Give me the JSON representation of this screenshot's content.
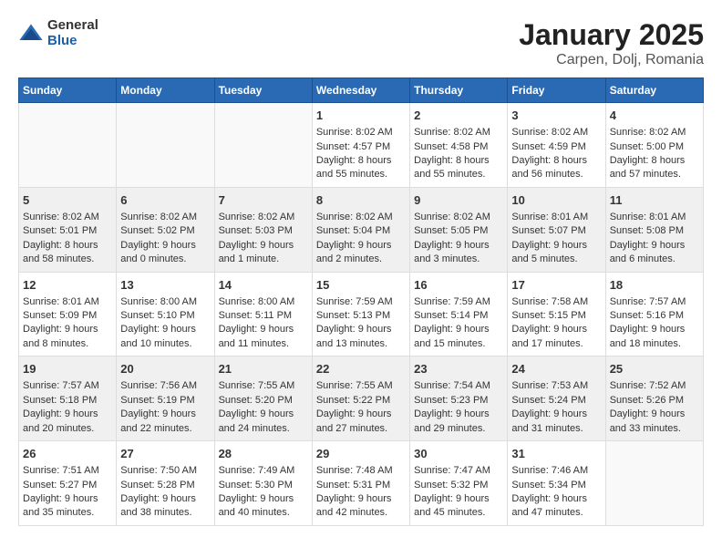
{
  "header": {
    "logo": {
      "general": "General",
      "blue": "Blue"
    },
    "title": "January 2025",
    "subtitle": "Carpen, Dolj, Romania"
  },
  "weekdays": [
    "Sunday",
    "Monday",
    "Tuesday",
    "Wednesday",
    "Thursday",
    "Friday",
    "Saturday"
  ],
  "weeks": [
    [
      {
        "day": "",
        "content": ""
      },
      {
        "day": "",
        "content": ""
      },
      {
        "day": "",
        "content": ""
      },
      {
        "day": "1",
        "content": "Sunrise: 8:02 AM\nSunset: 4:57 PM\nDaylight: 8 hours\nand 55 minutes."
      },
      {
        "day": "2",
        "content": "Sunrise: 8:02 AM\nSunset: 4:58 PM\nDaylight: 8 hours\nand 55 minutes."
      },
      {
        "day": "3",
        "content": "Sunrise: 8:02 AM\nSunset: 4:59 PM\nDaylight: 8 hours\nand 56 minutes."
      },
      {
        "day": "4",
        "content": "Sunrise: 8:02 AM\nSunset: 5:00 PM\nDaylight: 8 hours\nand 57 minutes."
      }
    ],
    [
      {
        "day": "5",
        "content": "Sunrise: 8:02 AM\nSunset: 5:01 PM\nDaylight: 8 hours\nand 58 minutes."
      },
      {
        "day": "6",
        "content": "Sunrise: 8:02 AM\nSunset: 5:02 PM\nDaylight: 9 hours\nand 0 minutes."
      },
      {
        "day": "7",
        "content": "Sunrise: 8:02 AM\nSunset: 5:03 PM\nDaylight: 9 hours\nand 1 minute."
      },
      {
        "day": "8",
        "content": "Sunrise: 8:02 AM\nSunset: 5:04 PM\nDaylight: 9 hours\nand 2 minutes."
      },
      {
        "day": "9",
        "content": "Sunrise: 8:02 AM\nSunset: 5:05 PM\nDaylight: 9 hours\nand 3 minutes."
      },
      {
        "day": "10",
        "content": "Sunrise: 8:01 AM\nSunset: 5:07 PM\nDaylight: 9 hours\nand 5 minutes."
      },
      {
        "day": "11",
        "content": "Sunrise: 8:01 AM\nSunset: 5:08 PM\nDaylight: 9 hours\nand 6 minutes."
      }
    ],
    [
      {
        "day": "12",
        "content": "Sunrise: 8:01 AM\nSunset: 5:09 PM\nDaylight: 9 hours\nand 8 minutes."
      },
      {
        "day": "13",
        "content": "Sunrise: 8:00 AM\nSunset: 5:10 PM\nDaylight: 9 hours\nand 10 minutes."
      },
      {
        "day": "14",
        "content": "Sunrise: 8:00 AM\nSunset: 5:11 PM\nDaylight: 9 hours\nand 11 minutes."
      },
      {
        "day": "15",
        "content": "Sunrise: 7:59 AM\nSunset: 5:13 PM\nDaylight: 9 hours\nand 13 minutes."
      },
      {
        "day": "16",
        "content": "Sunrise: 7:59 AM\nSunset: 5:14 PM\nDaylight: 9 hours\nand 15 minutes."
      },
      {
        "day": "17",
        "content": "Sunrise: 7:58 AM\nSunset: 5:15 PM\nDaylight: 9 hours\nand 17 minutes."
      },
      {
        "day": "18",
        "content": "Sunrise: 7:57 AM\nSunset: 5:16 PM\nDaylight: 9 hours\nand 18 minutes."
      }
    ],
    [
      {
        "day": "19",
        "content": "Sunrise: 7:57 AM\nSunset: 5:18 PM\nDaylight: 9 hours\nand 20 minutes."
      },
      {
        "day": "20",
        "content": "Sunrise: 7:56 AM\nSunset: 5:19 PM\nDaylight: 9 hours\nand 22 minutes."
      },
      {
        "day": "21",
        "content": "Sunrise: 7:55 AM\nSunset: 5:20 PM\nDaylight: 9 hours\nand 24 minutes."
      },
      {
        "day": "22",
        "content": "Sunrise: 7:55 AM\nSunset: 5:22 PM\nDaylight: 9 hours\nand 27 minutes."
      },
      {
        "day": "23",
        "content": "Sunrise: 7:54 AM\nSunset: 5:23 PM\nDaylight: 9 hours\nand 29 minutes."
      },
      {
        "day": "24",
        "content": "Sunrise: 7:53 AM\nSunset: 5:24 PM\nDaylight: 9 hours\nand 31 minutes."
      },
      {
        "day": "25",
        "content": "Sunrise: 7:52 AM\nSunset: 5:26 PM\nDaylight: 9 hours\nand 33 minutes."
      }
    ],
    [
      {
        "day": "26",
        "content": "Sunrise: 7:51 AM\nSunset: 5:27 PM\nDaylight: 9 hours\nand 35 minutes."
      },
      {
        "day": "27",
        "content": "Sunrise: 7:50 AM\nSunset: 5:28 PM\nDaylight: 9 hours\nand 38 minutes."
      },
      {
        "day": "28",
        "content": "Sunrise: 7:49 AM\nSunset: 5:30 PM\nDaylight: 9 hours\nand 40 minutes."
      },
      {
        "day": "29",
        "content": "Sunrise: 7:48 AM\nSunset: 5:31 PM\nDaylight: 9 hours\nand 42 minutes."
      },
      {
        "day": "30",
        "content": "Sunrise: 7:47 AM\nSunset: 5:32 PM\nDaylight: 9 hours\nand 45 minutes."
      },
      {
        "day": "31",
        "content": "Sunrise: 7:46 AM\nSunset: 5:34 PM\nDaylight: 9 hours\nand 47 minutes."
      },
      {
        "day": "",
        "content": ""
      }
    ]
  ]
}
